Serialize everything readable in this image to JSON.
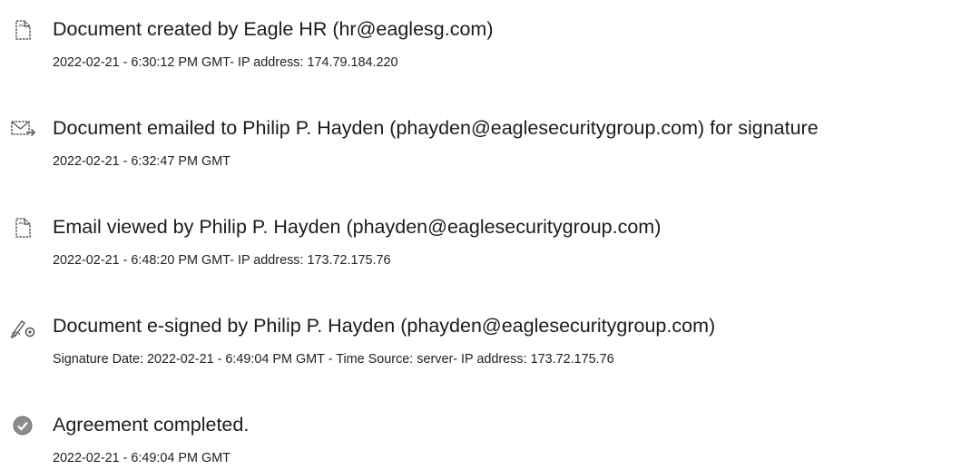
{
  "events": [
    {
      "icon": "document-icon",
      "title": "Document created by Eagle HR (hr@eaglesg.com)",
      "meta": "2022-02-21 - 6:30:12 PM GMT- IP address: 174.79.184.220"
    },
    {
      "icon": "email-icon",
      "title": "Document emailed to Philip P. Hayden (phayden@eaglesecuritygroup.com) for signature",
      "meta": "2022-02-21 - 6:32:47 PM GMT"
    },
    {
      "icon": "document-icon",
      "title": "Email viewed by Philip P. Hayden (phayden@eaglesecuritygroup.com)",
      "meta": "2022-02-21 - 6:48:20 PM GMT- IP address: 173.72.175.76"
    },
    {
      "icon": "pen-signature-icon",
      "title": "Document e-signed by Philip P. Hayden (phayden@eaglesecuritygroup.com)",
      "meta": "Signature Date: 2022-02-21 - 6:49:04 PM GMT - Time Source: server- IP address: 173.72.175.76"
    },
    {
      "icon": "checkmark-circle-icon",
      "title": "Agreement completed.",
      "meta": "2022-02-21 - 6:49:04 PM GMT"
    }
  ]
}
